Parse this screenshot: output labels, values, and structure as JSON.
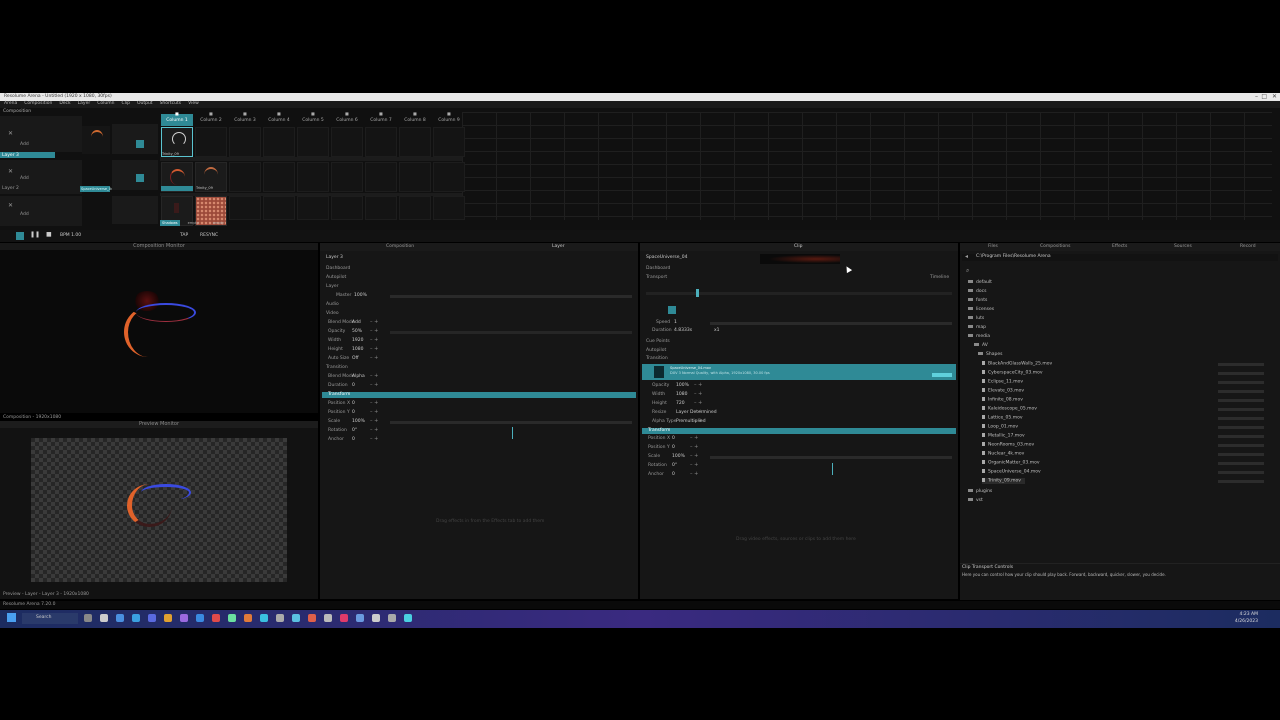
{
  "app": {
    "title": "Resolume Arena - Untitled (1920 x 1080, 30fps)",
    "menu": [
      "Arena",
      "Composition",
      "Deck",
      "Layer",
      "Column",
      "Clip",
      "Output",
      "Shortcuts",
      "View"
    ],
    "composition_label": "Composition",
    "status_left": "Resolume Arena 7.20.0"
  },
  "deck": {
    "columns": [
      "Column 1",
      "Column 2",
      "Column 3",
      "Column 4",
      "Column 5",
      "Column 6",
      "Column 7",
      "Column 8",
      "Column 9"
    ],
    "layers": [
      {
        "name": "Layer 3",
        "blend": "Add",
        "clip": "Trinity_09"
      },
      {
        "name": "Layer 2",
        "blend": "Add",
        "clip": "SpaceUniverse_04"
      },
      {
        "name": "Layer 1",
        "blend": "Add",
        "clip": ""
      }
    ],
    "bottom_clips": [
      "Shadows",
      "empty",
      "empty"
    ],
    "bpm": "BPM 1.00",
    "tap": "TAP",
    "resync": "RESYNC"
  },
  "monitors": {
    "composition_title": "Composition Monitor",
    "composition_info": "Composition - 1920x1080",
    "preview_title": "Preview Monitor",
    "preview_info": "Preview - Layer - Layer 3 - 1920x1080"
  },
  "layer_panel": {
    "tab_comp": "Composition",
    "tab_layer": "Layer",
    "layer_name": "Layer 3",
    "sections": {
      "dashboard": "Dashboard",
      "autopilot": "Autopilot",
      "layer": "Layer",
      "audio": "Audio",
      "video": "Video",
      "transition": "Transition",
      "transform": "Transform"
    },
    "master_label": "Master",
    "master_value": "100%",
    "params": [
      {
        "label": "Blend Mode",
        "value": "Add"
      },
      {
        "label": "Opacity",
        "value": "50%"
      },
      {
        "label": "Width",
        "value": "1920"
      },
      {
        "label": "Height",
        "value": "1080"
      },
      {
        "label": "Auto Size",
        "value": "Off"
      }
    ],
    "transition_params": [
      {
        "label": "Blend Mode",
        "value": "Alpha"
      },
      {
        "label": "Duration",
        "value": "0"
      }
    ],
    "transform_params": [
      {
        "label": "Position X",
        "value": "0"
      },
      {
        "label": "Position Y",
        "value": "0"
      },
      {
        "label": "Scale",
        "value": "100%"
      },
      {
        "label": "Rotation",
        "value": "0°"
      },
      {
        "label": "Anchor",
        "value": "0"
      }
    ],
    "hint": "Drag effects in from the Effects tab to add them"
  },
  "clip_panel": {
    "tab": "Clip",
    "clip_name": "SpaceUniverse_04",
    "sections": {
      "dashboard": "Dashboard",
      "transport": "Transport",
      "cuepoints": "Cue Points",
      "autopilot": "Autopilot",
      "transition": "Transition",
      "transform": "Transform"
    },
    "timeline_label": "Timeline",
    "speed_label": "Speed",
    "speed_value": "1",
    "duration_label": "Duration",
    "duration_value": "4.8333s",
    "duration_mult": "x1",
    "source_file": "SpaceUniverse_04.mov",
    "source_info": "DXV 3 Normal Quality, with Alpha, 1920x1080, 30.00 fps",
    "params": [
      {
        "label": "Opacity",
        "value": "100%"
      },
      {
        "label": "Width",
        "value": "1080"
      },
      {
        "label": "Height",
        "value": "720"
      },
      {
        "label": "Resize",
        "value": "Layer Determined"
      },
      {
        "label": "Alpha Type",
        "value": "Premultiplied"
      }
    ],
    "transform_params": [
      {
        "label": "Position X",
        "value": "0"
      },
      {
        "label": "Position Y",
        "value": "0"
      },
      {
        "label": "Scale",
        "value": "100%"
      },
      {
        "label": "Rotation",
        "value": "0°"
      },
      {
        "label": "Anchor",
        "value": "0"
      }
    ],
    "hint": "Drag video effects, sources or clips to add them here"
  },
  "browser": {
    "tabs": [
      "Files",
      "Compositions",
      "Effects",
      "Sources",
      "Record"
    ],
    "path": "C:\\Program Files\\Resolume Arena",
    "folders": [
      "default",
      "docs",
      "fonts",
      "licenses",
      "luts",
      "map",
      "media"
    ],
    "subfolders": [
      "AV",
      "Shapes"
    ],
    "files": [
      "BlackAndGlassWalls_25.mov",
      "CyberspaceCity_03.mov",
      "Eclipse_11.mov",
      "Elevate_03.mov",
      "Infinite_08.mov",
      "Kaleidoscope_05.mov",
      "Lattice_05.mov",
      "Loop_01.mov",
      "Metallic_17.mov",
      "NeonRooms_03.mov",
      "Nuclear_4k.mov",
      "OrganicMatter_03.mov",
      "SpaceUniverse_04.mov",
      "Trinity_09.mov"
    ],
    "bottom_folders": [
      "plugins",
      "vst"
    ],
    "transport_title": "Clip Transport Controls",
    "transport_desc": "Here you can control how your clip should play back. Forward, backward, quicker, slower, you decide."
  },
  "taskbar": {
    "search": "Search",
    "time": "4:23 AM",
    "date": "4/26/2023"
  }
}
